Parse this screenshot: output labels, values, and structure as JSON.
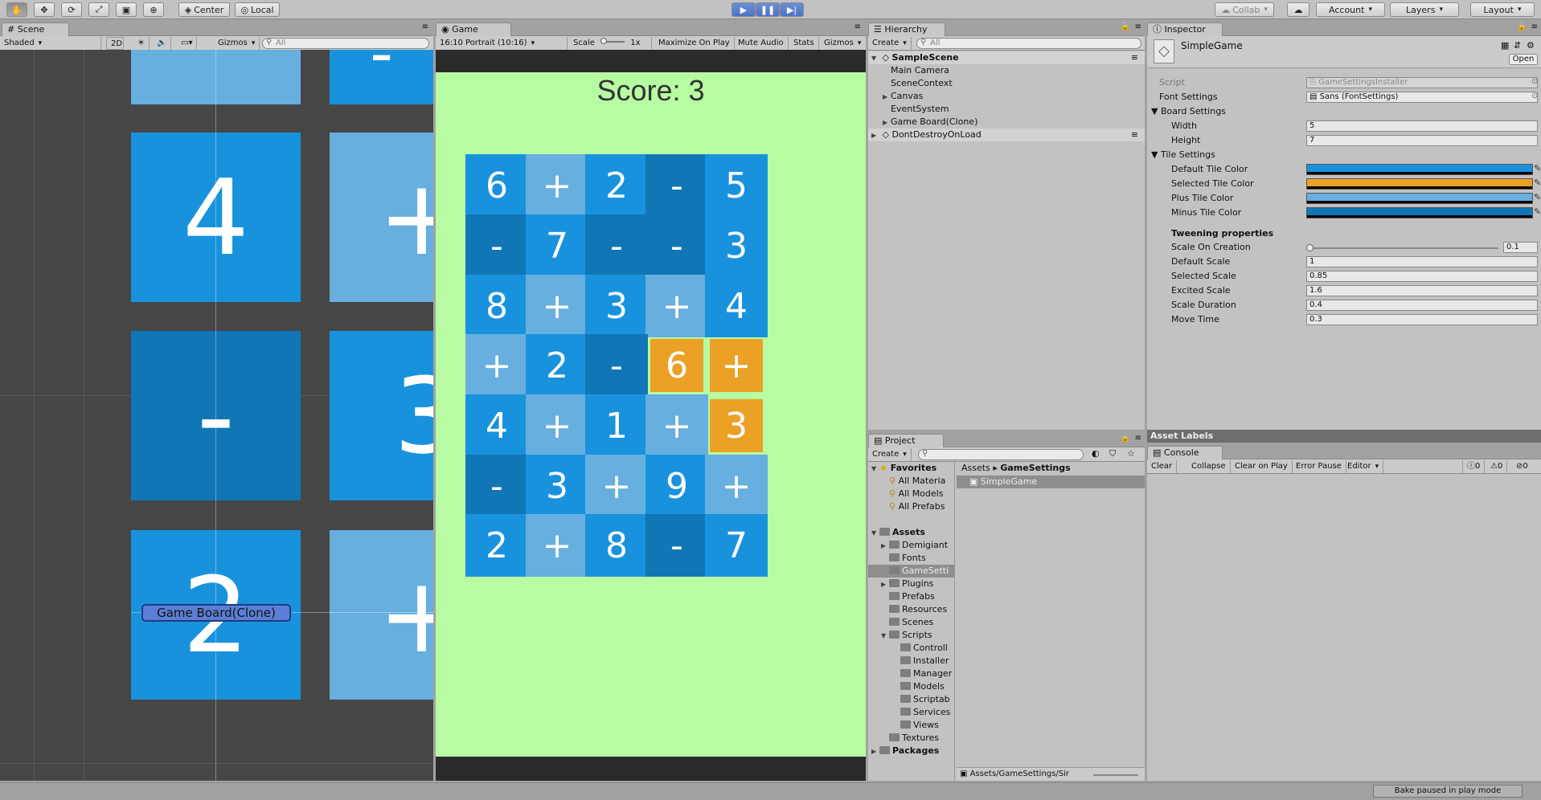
{
  "toolbar": {
    "tools": [
      "hand-tool",
      "move-tool",
      "rotate-tool",
      "scale-tool",
      "rect-tool",
      "transform-tool"
    ],
    "pivot_label": "Center",
    "space_label": "Local",
    "collab_label": "Collab",
    "account_label": "Account",
    "layers_label": "Layers",
    "layout_label": "Layout"
  },
  "scene": {
    "tab_label": "Scene",
    "shading_label": "Shaded",
    "mode_2d_label": "2D",
    "gizmos_label": "Gizmos",
    "search_placeholder": "All",
    "selection_label": "Game Board(Clone)",
    "tiles": [
      {
        "text": "",
        "color": "#66afdf"
      },
      {
        "text": "-",
        "color": "#1992de"
      },
      {
        "text": "4",
        "color": "#1992de"
      },
      {
        "text": "+",
        "color": "#66afdf"
      },
      {
        "text": "-",
        "color": "#1176b6"
      },
      {
        "text": "3",
        "color": "#1992de"
      },
      {
        "text": "2",
        "color": "#1992de"
      },
      {
        "text": "+",
        "color": "#66afdf"
      }
    ]
  },
  "game": {
    "tab_label": "Game",
    "aspect_label": "16:10 Portrait (10:16)",
    "scale_label": "Scale",
    "scale_value": "1x",
    "maximize_label": "Maximize On Play",
    "mute_label": "Mute Audio",
    "stats_label": "Stats",
    "gizmos_label": "Gizmos",
    "score_text": "Score: 3",
    "grid": [
      [
        {
          "t": "6",
          "k": "num"
        },
        {
          "t": "+",
          "k": "plus"
        },
        {
          "t": "2",
          "k": "num"
        },
        {
          "t": "-",
          "k": "minus"
        },
        {
          "t": "5",
          "k": "num"
        }
      ],
      [
        {
          "t": "-",
          "k": "minus"
        },
        {
          "t": "7",
          "k": "num"
        },
        {
          "t": "-",
          "k": "minus"
        },
        {
          "t": "-",
          "k": "minus"
        },
        {
          "t": "3",
          "k": "num"
        }
      ],
      [
        {
          "t": "8",
          "k": "num"
        },
        {
          "t": "+",
          "k": "plus"
        },
        {
          "t": "3",
          "k": "num"
        },
        {
          "t": "+",
          "k": "plus"
        },
        {
          "t": "4",
          "k": "num"
        }
      ],
      [
        {
          "t": "+",
          "k": "plus"
        },
        {
          "t": "2",
          "k": "num"
        },
        {
          "t": "-",
          "k": "minus"
        },
        {
          "t": "6",
          "k": "selected"
        },
        {
          "t": "+",
          "k": "selected"
        }
      ],
      [
        {
          "t": "4",
          "k": "num"
        },
        {
          "t": "+",
          "k": "plus"
        },
        {
          "t": "1",
          "k": "num"
        },
        {
          "t": "+",
          "k": "plus"
        },
        {
          "t": "3",
          "k": "selected"
        }
      ],
      [
        {
          "t": "-",
          "k": "minus"
        },
        {
          "t": "3",
          "k": "num"
        },
        {
          "t": "+",
          "k": "plus"
        },
        {
          "t": "9",
          "k": "num"
        },
        {
          "t": "+",
          "k": "plus"
        }
      ],
      [
        {
          "t": "2",
          "k": "num"
        },
        {
          "t": "+",
          "k": "plus"
        },
        {
          "t": "8",
          "k": "num"
        },
        {
          "t": "-",
          "k": "minus"
        },
        {
          "t": "7",
          "k": "num"
        }
      ]
    ],
    "colors": {
      "num": "#1992de",
      "plus": "#66afdf",
      "minus": "#1176b6",
      "selected": "#eba126"
    }
  },
  "hierarchy": {
    "tab_label": "Hierarchy",
    "create_label": "Create",
    "search_placeholder": "All",
    "scene_name": "SampleScene",
    "items": [
      {
        "label": "Main Camera",
        "arrow": false
      },
      {
        "label": "SceneContext",
        "arrow": false
      },
      {
        "label": "Canvas",
        "arrow": true
      },
      {
        "label": "EventSystem",
        "arrow": false
      },
      {
        "label": "Game Board(Clone)",
        "arrow": true
      }
    ],
    "dontdestroy_label": "DontDestroyOnLoad"
  },
  "inspector": {
    "tab_label": "Inspector",
    "object_name": "SimpleGame",
    "open_label": "Open",
    "script_label": "Script",
    "script_value": "GameSettingsInstaller",
    "font_settings_label": "Font Settings",
    "font_settings_value": "Sans (FontSettings)",
    "board_settings_label": "Board Settings",
    "width_label": "Width",
    "width_value": "5",
    "height_label": "Height",
    "height_value": "7",
    "tile_settings_label": "Tile Settings",
    "default_tile_color_label": "Default Tile Color",
    "selected_tile_color_label": "Selected Tile Color",
    "plus_tile_color_label": "Plus Tile Color",
    "minus_tile_color_label": "Minus Tile Color",
    "default_tile_color": "#1992de",
    "selected_tile_color": "#eba126",
    "plus_tile_color": "#66afdf",
    "minus_tile_color": "#1176b6",
    "tweening_label": "Tweening properties",
    "scale_on_creation_label": "Scale On Creation",
    "scale_on_creation_value": "0.1",
    "default_scale_label": "Default Scale",
    "default_scale_value": "1",
    "selected_scale_label": "Selected Scale",
    "selected_scale_value": "0.85",
    "excited_scale_label": "Excited Scale",
    "excited_scale_value": "1.6",
    "scale_duration_label": "Scale Duration",
    "scale_duration_value": "0.4",
    "move_time_label": "Move Time",
    "move_time_value": "0.3",
    "asset_labels": "Asset Labels"
  },
  "project": {
    "tab_label": "Project",
    "create_label": "Create",
    "favorites_label": "Favorites",
    "favorites": [
      "All Materia",
      "All Models",
      "All Prefabs"
    ],
    "assets_label": "Assets",
    "asset_folders": [
      "Demigiant",
      "Fonts",
      "GameSetti",
      "Plugins",
      "Prefabs",
      "Resources",
      "Scenes",
      "Scripts"
    ],
    "script_folders": [
      "Controll",
      "Installer",
      "Manager",
      "Models",
      "Scriptab",
      "Services",
      "Views"
    ],
    "textures_label": "Textures",
    "packages_label": "Packages",
    "breadcrumb_root": "Assets",
    "breadcrumb_current": "GameSettings",
    "selected_asset": "SimpleGame",
    "path_text": "Assets/GameSettings/Sir"
  },
  "console": {
    "tab_label": "Console",
    "clear_label": "Clear",
    "collapse_label": "Collapse",
    "clear_on_play_label": "Clear on Play",
    "error_pause_label": "Error Pause",
    "editor_label": "Editor",
    "info_count": "0",
    "warn_count": "0",
    "error_count": "0"
  },
  "status": {
    "bake_text": "Bake paused in play mode"
  }
}
